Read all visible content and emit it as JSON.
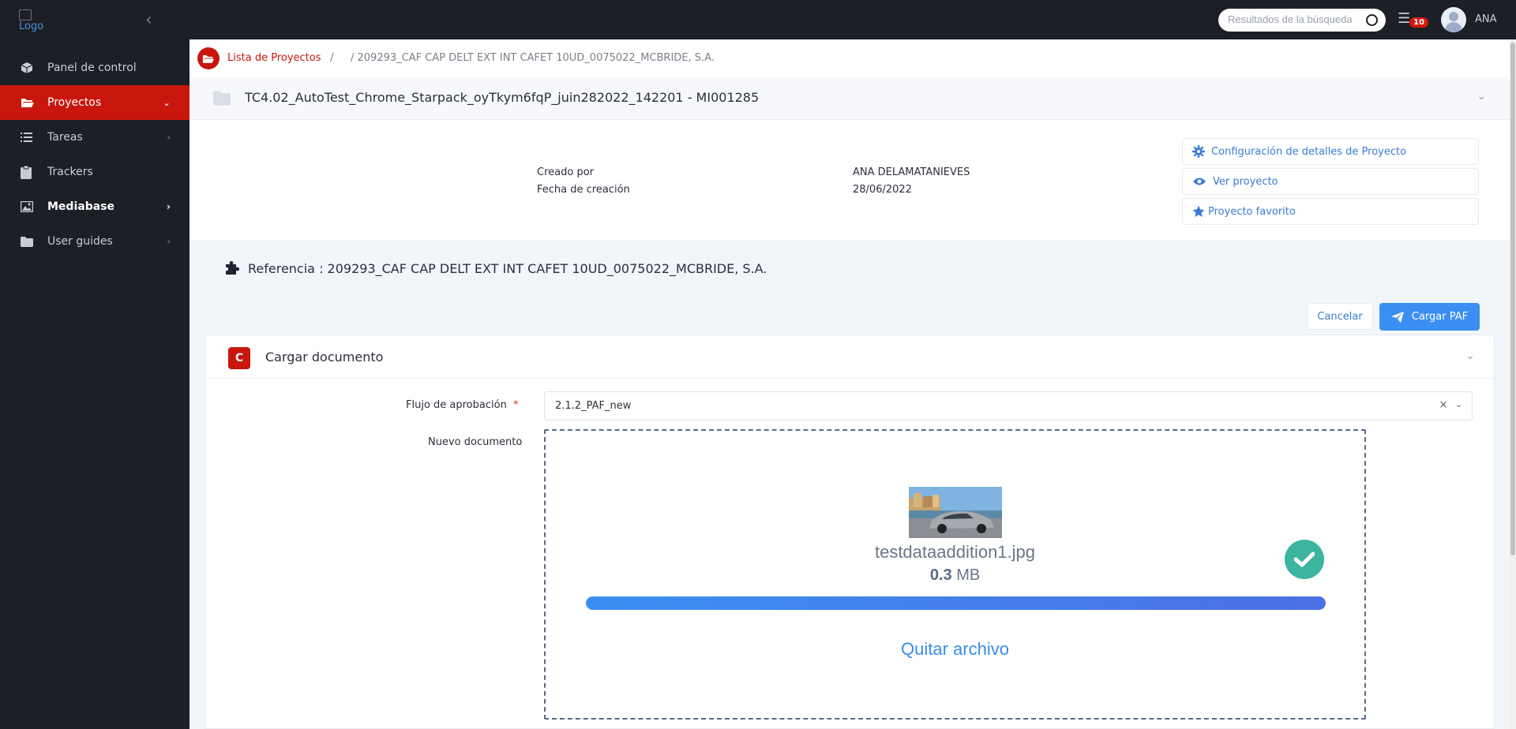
{
  "app": {
    "logo_alt": "Logo",
    "user_name": "ANA",
    "search_placeholder": "Resultados de la búsqueda",
    "notifications_count": "10"
  },
  "sidebar": {
    "items": [
      {
        "label": "Panel de control",
        "icon": "cube-icon"
      },
      {
        "label": "Proyectos",
        "icon": "folder-open-icon",
        "active": true
      },
      {
        "label": "Tareas",
        "icon": "list-icon"
      },
      {
        "label": "Trackers",
        "icon": "clipboard-icon"
      },
      {
        "label": "Mediabase",
        "icon": "image-icon"
      },
      {
        "label": "User guides",
        "icon": "folder-icon"
      }
    ]
  },
  "breadcrumb": {
    "link": "Lista de Proyectos",
    "separator": "/",
    "current": "/ 209293_CAF CAP DELT EXT INT CAFET 10UD_0075022_MCBRIDE, S.A."
  },
  "project": {
    "title": "TC4.02_AutoTest_Chrome_Starpack_oyTkym6fqP_juin282022_142201 - MI001285",
    "created_by_label": "Creado por",
    "created_by_value": "ANA DELAMATANIEVES",
    "created_date_label": "Fecha de creación",
    "created_date_value": "28/06/2022",
    "actions": {
      "config": "Configuración de detalles de Proyecto",
      "view": "Ver proyecto",
      "favorite": "Proyecto favorito"
    },
    "reference": "Referencia : 209293_CAF CAP DELT EXT INT CAFET 10UD_0075022_MCBRIDE, S.A."
  },
  "buttons": {
    "cancel": "Cancelar",
    "upload": "Cargar PAF"
  },
  "upload_card": {
    "badge": "C",
    "title": "Cargar documento",
    "flow_label": "Flujo de aprobación",
    "required_mark": "*",
    "flow_value": "2.1.2_PAF_new",
    "new_doc_label": "Nuevo documento",
    "file_name": "testdataaddition1.jpg",
    "file_size_value": "0.3",
    "file_size_unit": "MB",
    "progress_fraction": 1.0,
    "remove_label": "Quitar archivo"
  },
  "colors": {
    "brand_red": "#c8160d",
    "primary_blue": "#3b8ff2",
    "success_green": "#3cb5a0"
  }
}
